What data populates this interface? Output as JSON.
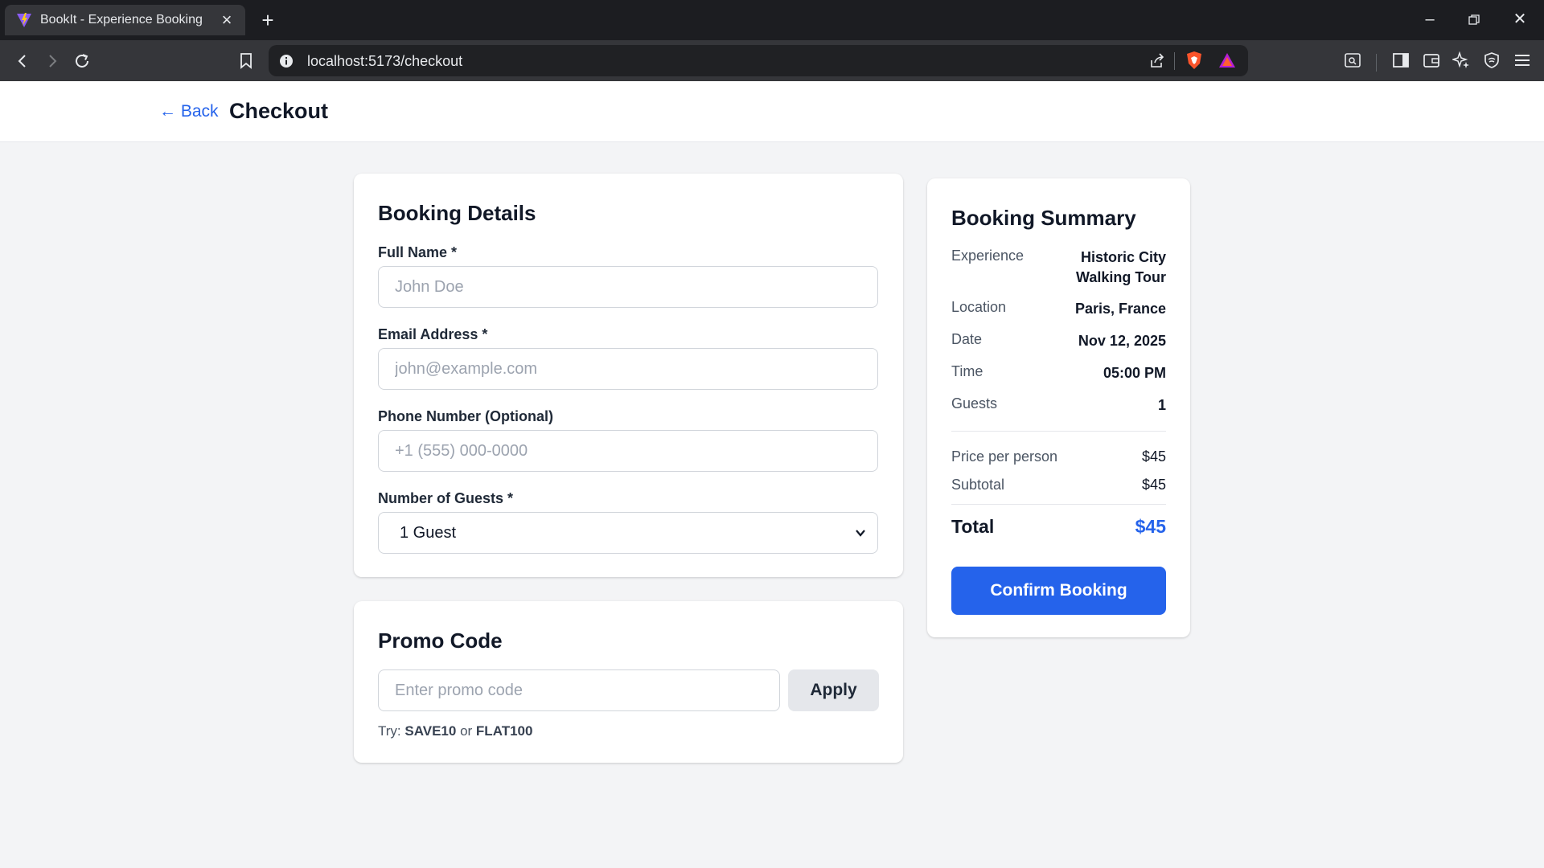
{
  "browser": {
    "tab_title": "BookIt - Experience Booking",
    "url": "localhost:5173/checkout"
  },
  "header": {
    "back_label": "← Back",
    "title": "Checkout"
  },
  "booking_details": {
    "title": "Booking Details",
    "full_name": {
      "label": "Full Name *",
      "placeholder": "John Doe"
    },
    "email": {
      "label": "Email Address *",
      "placeholder": "john@example.com"
    },
    "phone": {
      "label": "Phone Number (Optional)",
      "placeholder": "+1 (555) 000-0000"
    },
    "guests": {
      "label": "Number of Guests *",
      "selected": "1 Guest"
    }
  },
  "promo": {
    "title": "Promo Code",
    "placeholder": "Enter promo code",
    "apply_label": "Apply",
    "hint_prefix": "Try:",
    "code1": "SAVE10",
    "hint_or": "or",
    "code2": "FLAT100"
  },
  "summary": {
    "title": "Booking Summary",
    "rows": [
      {
        "label": "Experience",
        "value": "Historic City Walking Tour"
      },
      {
        "label": "Location",
        "value": "Paris, France"
      },
      {
        "label": "Date",
        "value": "Nov 12, 2025"
      },
      {
        "label": "Time",
        "value": "05:00 PM"
      },
      {
        "label": "Guests",
        "value": "1"
      }
    ],
    "price_per_person": {
      "label": "Price per person",
      "value": "$45"
    },
    "subtotal": {
      "label": "Subtotal",
      "value": "$45"
    },
    "total": {
      "label": "Total",
      "value": "$45"
    },
    "confirm_label": "Confirm Booking"
  },
  "colors": {
    "accent": "#2563eb",
    "page_bg": "#f3f4f6",
    "card_bg": "#ffffff",
    "browser_frame": "#1c1d21"
  }
}
